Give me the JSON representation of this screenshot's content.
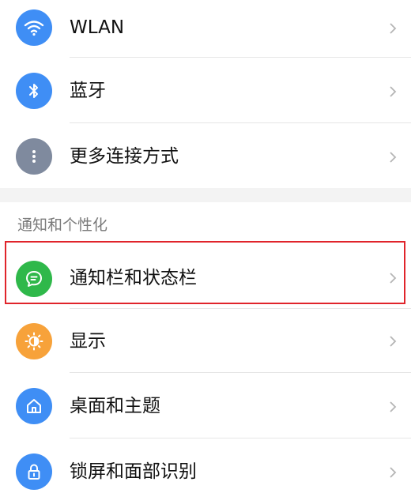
{
  "icons": {
    "wlan": "wifi-icon",
    "bluetooth": "bluetooth-icon",
    "more_connections": "more-dots-icon",
    "notification_bar": "chat-bubble-icon",
    "display": "brightness-icon",
    "home_theme": "home-icon",
    "lock_face": "lock-icon"
  },
  "colors": {
    "wlan": "#3f8ef5",
    "bluetooth": "#3f8ef5",
    "more_connections": "#7f8a9e",
    "notification_bar": "#2fb84a",
    "display": "#f7a23a",
    "home_theme": "#3f8ef5",
    "lock_face": "#3f8ef5",
    "highlight": "#e0242b"
  },
  "connections": {
    "items": [
      {
        "label": "WLAN"
      },
      {
        "label": "蓝牙"
      },
      {
        "label": "更多连接方式"
      }
    ]
  },
  "personalization": {
    "header": "通知和个性化",
    "items": [
      {
        "label": "通知栏和状态栏"
      },
      {
        "label": "显示"
      },
      {
        "label": "桌面和主题"
      },
      {
        "label": "锁屏和面部识别"
      }
    ]
  }
}
